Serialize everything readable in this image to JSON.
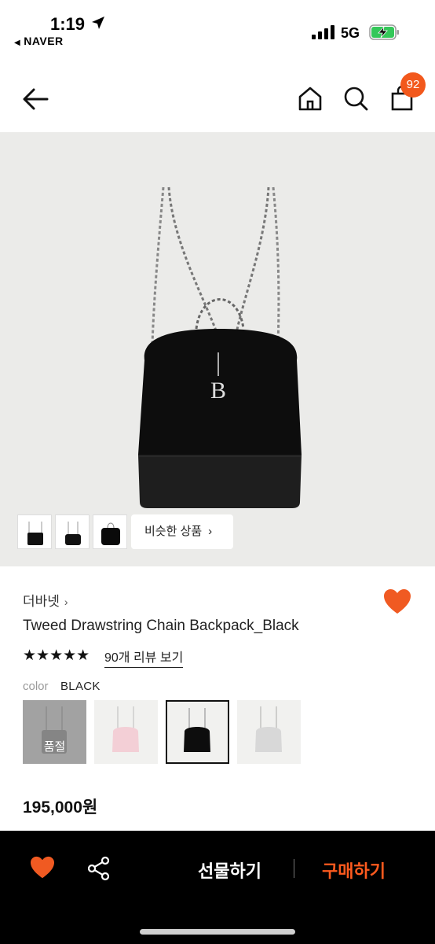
{
  "status_bar": {
    "time": "1:19",
    "back_app": "NAVER",
    "network": "5G"
  },
  "header": {
    "cart_count": "92"
  },
  "hero": {
    "similar_label": "비슷한 상품"
  },
  "product": {
    "brand": "더바넷",
    "title": "Tweed Drawstring Chain Backpack_Black",
    "stars": "★★★★★",
    "reviews_label": "90개 리뷰 보기",
    "color_label": "color",
    "color_value": "BLACK",
    "soldout_label": "품절",
    "price": "195,000원"
  },
  "bottom": {
    "gift_label": "선물하기",
    "buy_label": "구매하기"
  },
  "colors": {
    "accent": "#f2581c",
    "heart": "#f05a22",
    "buy_text": "#ff5a1e"
  }
}
